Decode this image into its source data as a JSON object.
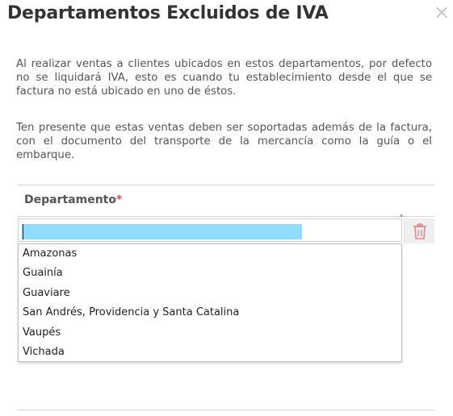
{
  "dialog": {
    "title": "Departamentos Excluidos de IVA",
    "close_glyph": "×",
    "paragraph_1": "Al realizar ventas a clientes ubicados en estos departamentos, por defecto no se liquidará IVA, esto es cuando tu establecimiento desde el que se factura no está ubicado en uno de éstos.",
    "paragraph_2": "Ten presente que estas ventas deben ser soportadas además de la factura, con el documento del transporte de la mercancía como la guía o el embarque."
  },
  "form": {
    "field_label": "Departamento",
    "required_mark": "*",
    "input_value": "",
    "delete_icon": "trash-icon",
    "delete_color": "#e8868f",
    "options": [
      "Amazonas",
      "Guainía",
      "Guaviare",
      "San Andrés, Providencia y Santa Catalina",
      "Vaupés",
      "Vichada"
    ]
  }
}
